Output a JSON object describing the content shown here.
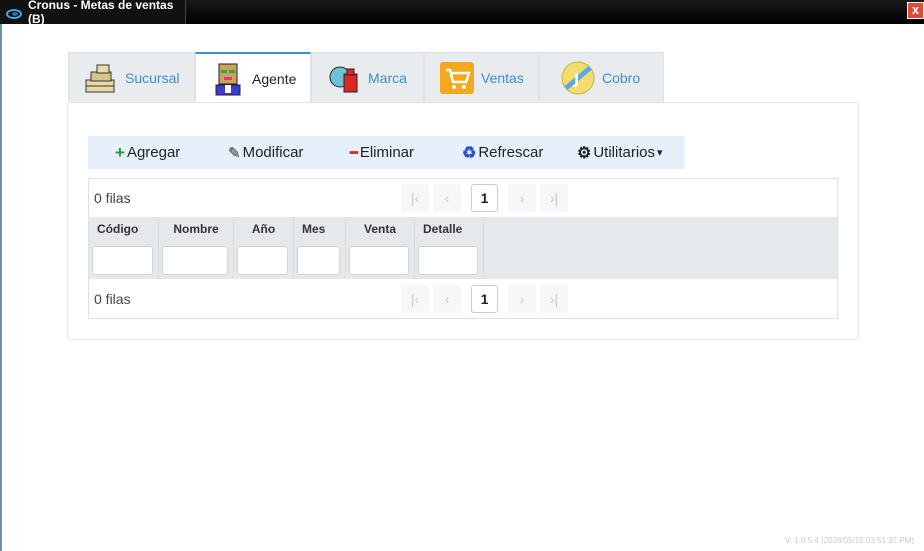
{
  "window": {
    "title": "Cronus - Metas de ventas (B)",
    "close_glyph": "x"
  },
  "tabs": [
    {
      "label": "Sucursal",
      "icon": "building-icon",
      "active": false
    },
    {
      "label": "Agente",
      "icon": "person-icon",
      "active": true
    },
    {
      "label": "Marca",
      "icon": "brand-icon",
      "active": false
    },
    {
      "label": "Ventas",
      "icon": "cart-icon",
      "active": false
    },
    {
      "label": "Cobro",
      "icon": "coin-icon",
      "active": false
    }
  ],
  "toolbar": {
    "add": {
      "label": "Agregar",
      "glyph": "+"
    },
    "edit": {
      "label": "Modificar",
      "glyph": "✎"
    },
    "delete": {
      "label": "Eliminar",
      "glyph": "━"
    },
    "refresh": {
      "label": "Refrescar",
      "glyph": "♻"
    },
    "utilities": {
      "label": "Utilitarios",
      "glyph": "⚙",
      "caret": "▾"
    }
  },
  "grid": {
    "top_rows_count": "0 filas",
    "bottom_rows_count": "0 filas",
    "current_page": "1",
    "pager_glyphs": {
      "first": "|‹",
      "prev": "‹",
      "next": "›",
      "last": "›|"
    },
    "columns": [
      "Código",
      "Nombre",
      "Año",
      "Mes",
      "Venta",
      "Detalle"
    ]
  },
  "colors": {
    "accent": "#3a8fd0",
    "toolbar_bg": "#e6f0fa",
    "header_bg": "#e6e9ec",
    "add": "#1e9e2f",
    "delete": "#e02020",
    "refresh": "#2a4fd0"
  },
  "version": "V: 1.0.5.4 (2026/05/15 03:51:37 PM)"
}
